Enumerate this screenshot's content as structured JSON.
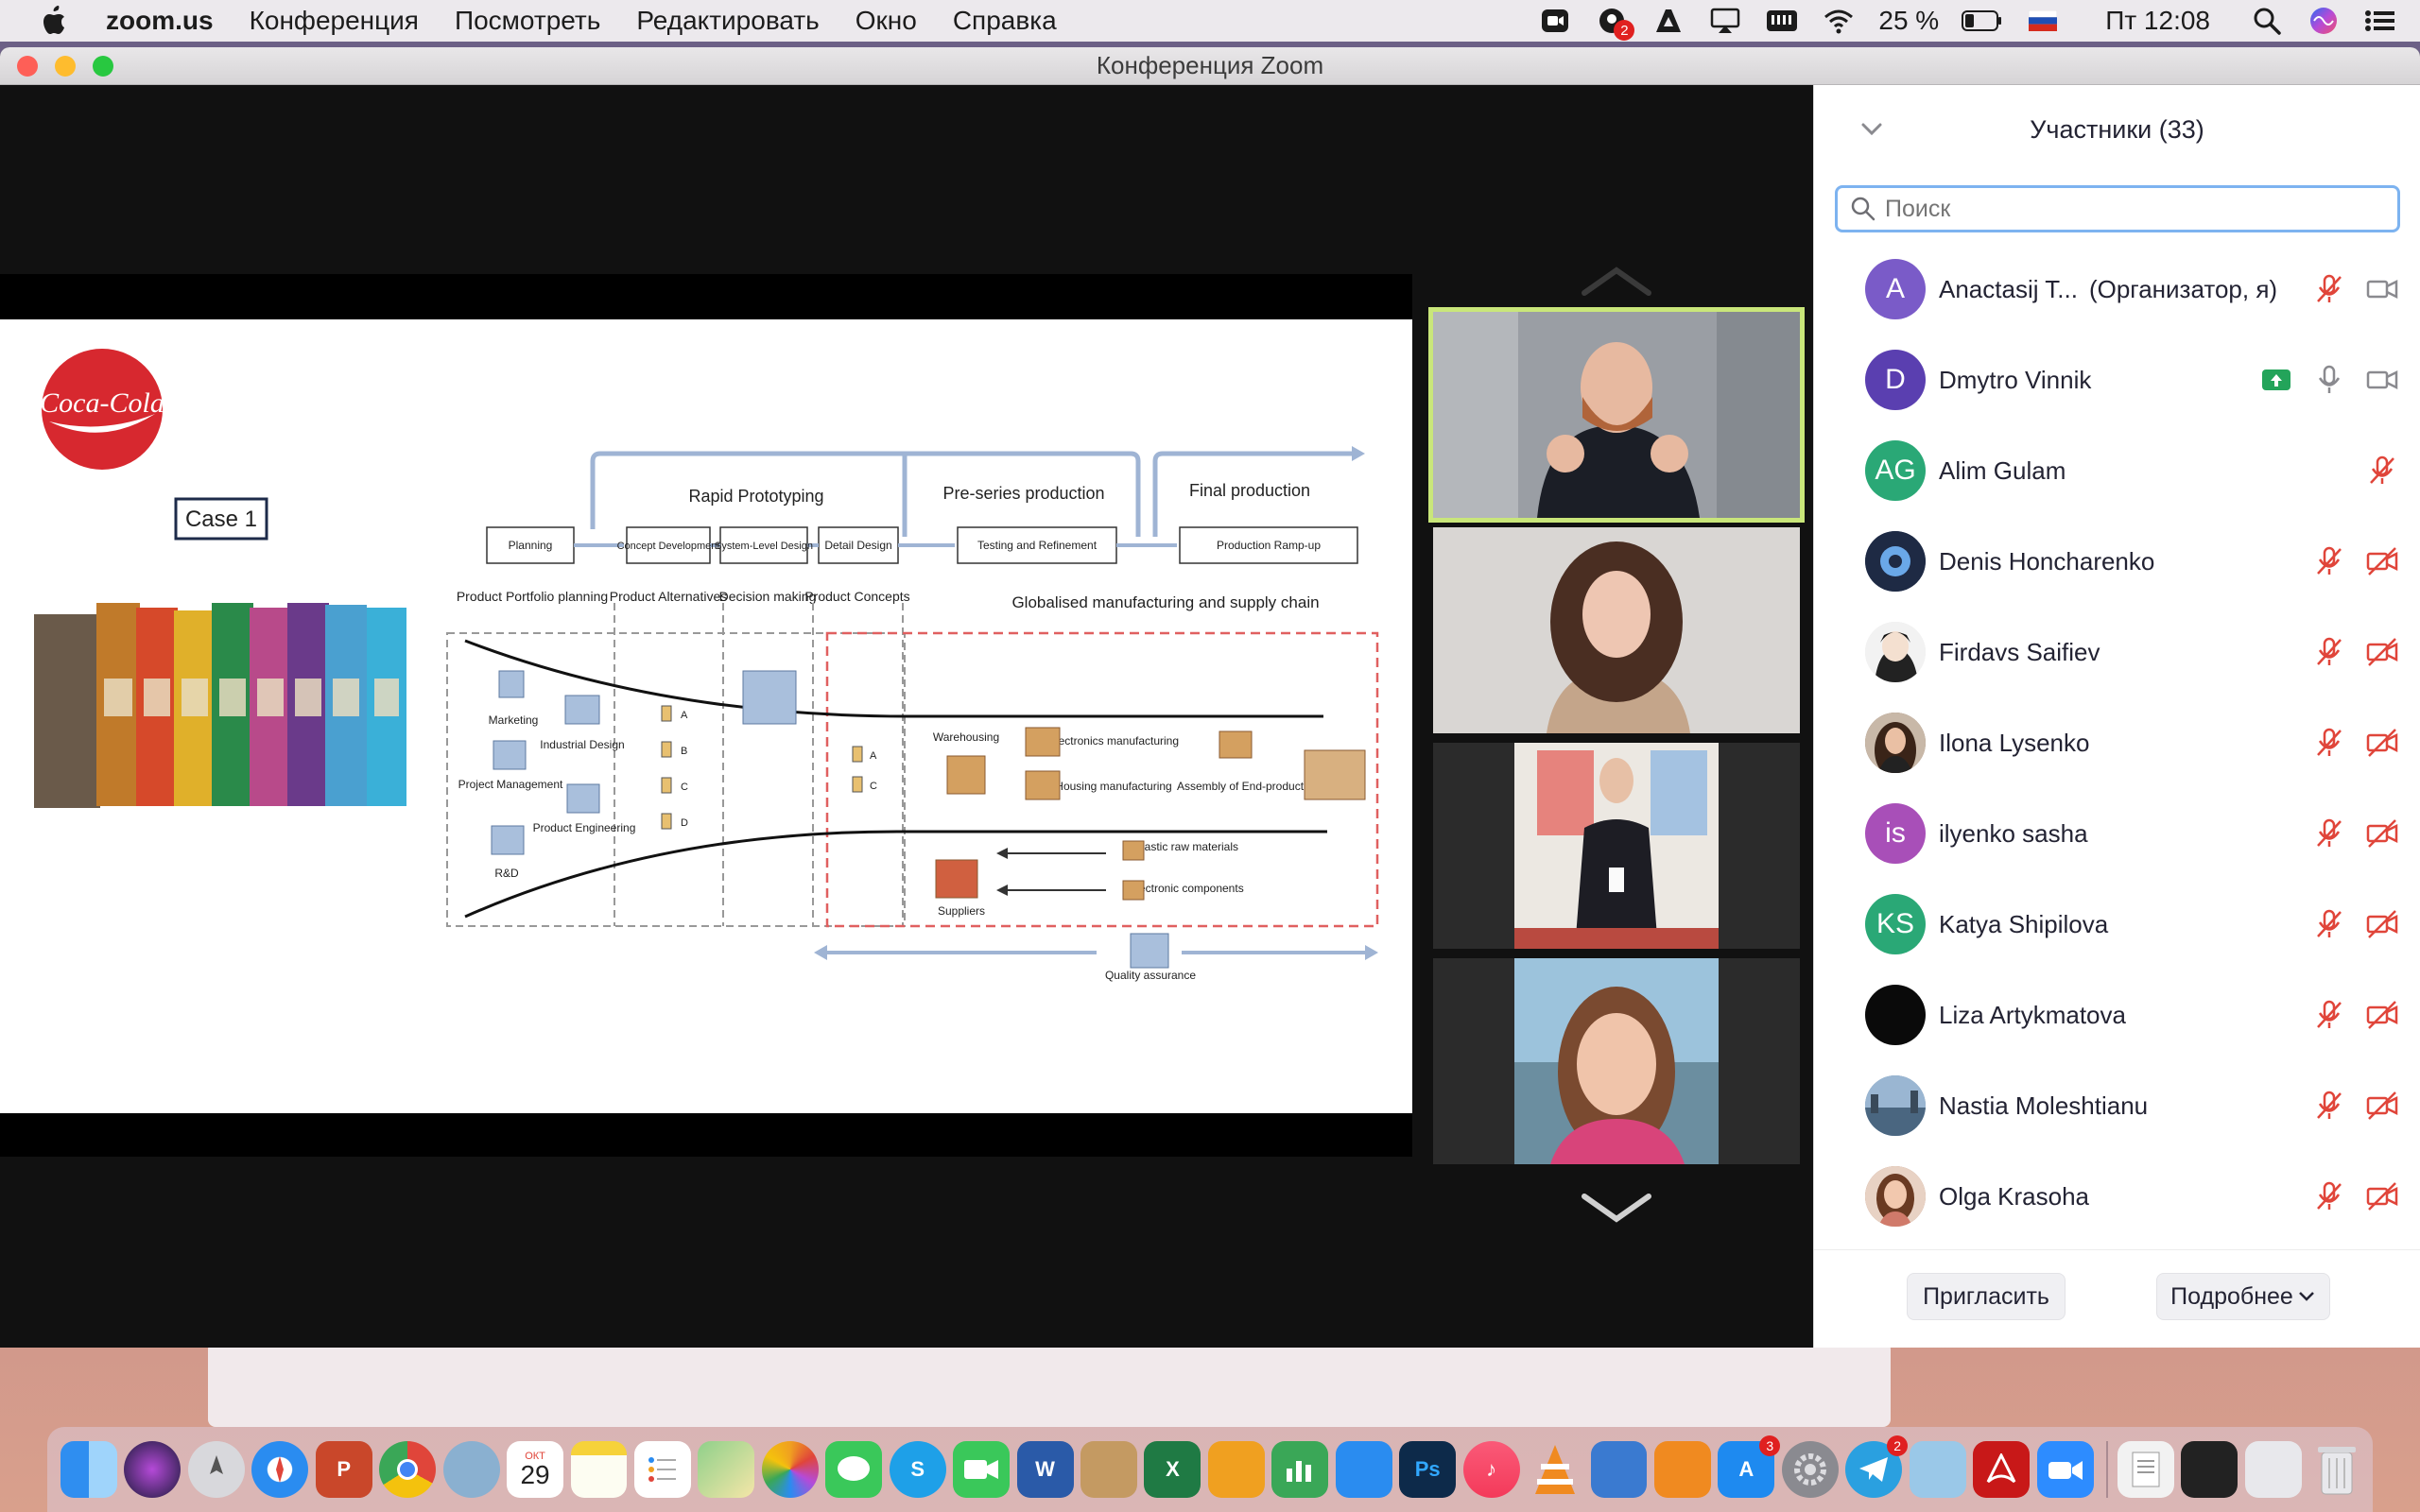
{
  "menubar": {
    "app_name": "zoom.us",
    "menus": [
      "Конференция",
      "Посмотреть",
      "Редактировать",
      "Окно",
      "Справка"
    ],
    "notification_count": "2",
    "battery": "25 %",
    "clock": "Пт 12:08"
  },
  "window": {
    "title": "Конференция Zoom"
  },
  "slide": {
    "case_label": "Case 1",
    "brand_text": "Coca-Cola",
    "stages": [
      "Rapid Prototyping",
      "Pre-series production",
      "Final production"
    ],
    "boxes": [
      "Planning",
      "Concept Development",
      "System-Level Design",
      "Detail Design",
      "Testing and Refinement",
      "Production Ramp-up"
    ],
    "columns": [
      "Product Portfolio planning",
      "Product Alternatives",
      "Decision making",
      "Product Concepts",
      "Globalised manufacturing and supply chain"
    ],
    "items": [
      "Marketing",
      "Industrial Design",
      "Project Management",
      "Product Engineering",
      "R&D",
      "Warehousing",
      "Electronics manufacturing",
      "Housing manufacturing",
      "Assembly of End-product",
      "Plastic raw materials",
      "Electronic components",
      "Suppliers",
      "Quality assurance"
    ],
    "options_a": [
      "A",
      "B",
      "C",
      "D"
    ],
    "options_b": [
      "A",
      "C"
    ]
  },
  "panel": {
    "title": "Участники (33)",
    "search_placeholder": "Поиск",
    "invite_label": "Пригласить",
    "more_label": "Подробнее",
    "participants": [
      {
        "initials": "A",
        "name": "Anactasij T...",
        "role": "(Организатор, я)",
        "color": "#7a5bc8"
      },
      {
        "initials": "D",
        "name": "Dmytro Vinnik",
        "role": "",
        "color": "#5a3fb0"
      },
      {
        "initials": "AG",
        "name": "Alim Gulam",
        "role": "",
        "color": "#2aa876"
      },
      {
        "initials": "",
        "name": "Denis Honcharenko",
        "role": "",
        "color": "#2b3a5a"
      },
      {
        "initials": "",
        "name": "Firdavs Saifiev",
        "role": "",
        "color": "#cfcfcf"
      },
      {
        "initials": "",
        "name": "Ilona Lysenko",
        "role": "",
        "color": "#8a6a50"
      },
      {
        "initials": "is",
        "name": "ilyenko sasha",
        "role": "",
        "color": "#a84fb8"
      },
      {
        "initials": "KS",
        "name": "Katya Shipilova",
        "role": "",
        "color": "#2aa876"
      },
      {
        "initials": "",
        "name": "Liza Artykmatova",
        "role": "",
        "color": "#0a0a0a"
      },
      {
        "initials": "",
        "name": "Nastia Moleshtianu",
        "role": "",
        "color": "#6c8aa8"
      },
      {
        "initials": "",
        "name": "Olga Krasoha",
        "role": "",
        "color": "#b07a60"
      }
    ]
  },
  "dock": {
    "calendar_month": "ОКТ",
    "calendar_day": "29",
    "appstore_badge": "3",
    "telegram_badge": "2"
  },
  "colors": {
    "accent": "#2d8cff",
    "mute_red": "#e0453a",
    "share_green": "#23a45a",
    "active_speaker": "#c9e67a"
  }
}
